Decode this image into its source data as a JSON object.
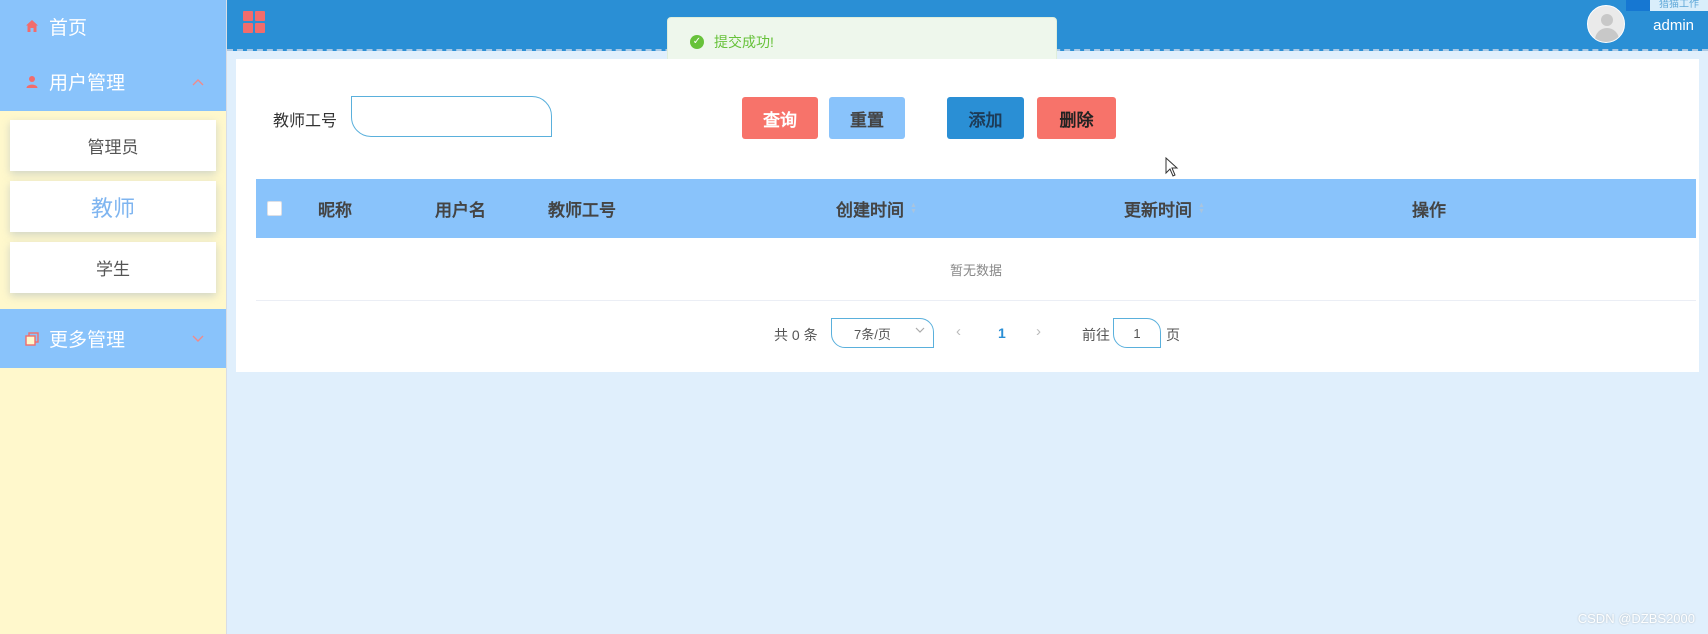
{
  "sidebar": {
    "home_label": "首页",
    "user_mgmt": {
      "label": "用户管理",
      "items": [
        "管理员",
        "教师",
        "学生"
      ],
      "active_index": 1
    },
    "more_mgmt": {
      "label": "更多管理"
    }
  },
  "header": {
    "username": "admin",
    "corner_badge_text": "猎猫工作"
  },
  "toast": {
    "message": "提交成功!"
  },
  "search": {
    "label": "教师工号",
    "value": "",
    "placeholder": ""
  },
  "toolbar": {
    "query_label": "查询",
    "reset_label": "重置",
    "add_label": "添加",
    "delete_label": "删除"
  },
  "table": {
    "columns": [
      "昵称",
      "用户名",
      "教师工号",
      "创建时间",
      "更新时间",
      "操作"
    ],
    "empty_text": "暂无数据"
  },
  "pagination": {
    "total_text": "共 0 条",
    "page_size": "7条/页",
    "current_page": "1",
    "goto_label": "前往",
    "goto_value": "1",
    "page_unit": "页"
  },
  "watermark": "CSDN @DZBS2000",
  "colors": {
    "header": "#2a8fd5",
    "sidebar_menu": "#89c3fb",
    "sidebar_bg": "#fff8cc",
    "danger": "#f7736a",
    "success": "#67c23a",
    "page_bg": "#e0effc"
  }
}
